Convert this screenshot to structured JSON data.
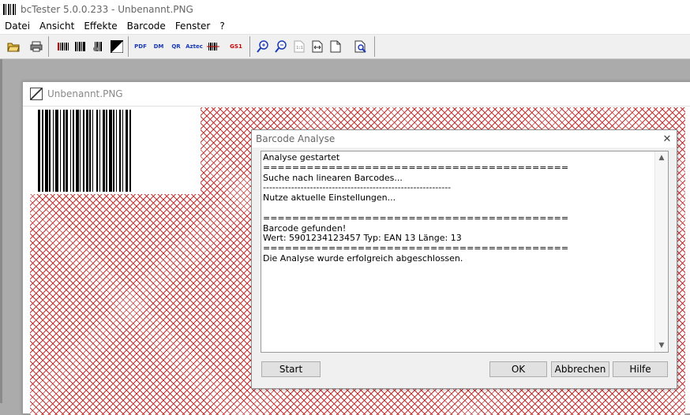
{
  "app": {
    "title": "bcTester 5.0.0.233 - Unbenannt.PNG"
  },
  "menu": {
    "items": [
      "Datei",
      "Ansicht",
      "Effekte",
      "Barcode",
      "Fenster",
      "?"
    ]
  },
  "toolbar": {
    "open_icon": "folder-open-icon",
    "print_icon": "printer-icon",
    "pdf_label": "PDF",
    "dm_label": "DM",
    "qr_label": "QR",
    "aztec_label": "Aztec",
    "gs1_label": "GS1"
  },
  "child_window": {
    "title": "Unbenannt.PNG"
  },
  "dialog": {
    "title": "Barcode Analyse",
    "log_lines": [
      "Analyse gestartet",
      "==========================================",
      "Suche nach linearen Barcodes...",
      "------------------------------------------------------------",
      "Nutze aktuelle Einstellungen...",
      "",
      "==========================================",
      "Barcode gefunden!",
      "Wert: 5901234123457 Typ: EAN 13 Länge: 13",
      "==========================================",
      "Die Analyse wurde erfolgreich abgeschlossen."
    ],
    "buttons": {
      "start": "Start",
      "ok": "OK",
      "cancel": "Abbrechen",
      "help": "Hilfe"
    }
  }
}
